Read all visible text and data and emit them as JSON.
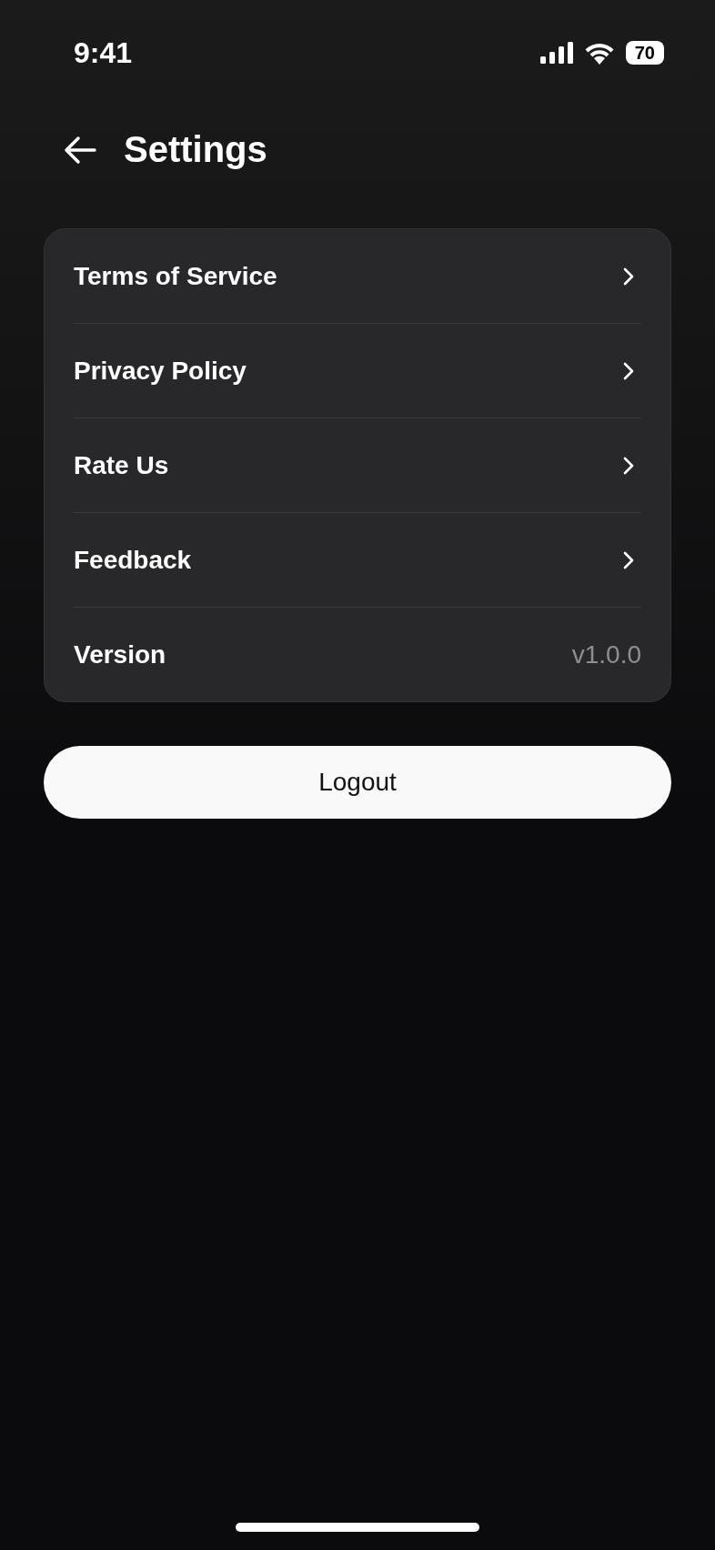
{
  "status_bar": {
    "time": "9:41",
    "battery": "70"
  },
  "header": {
    "title": "Settings"
  },
  "settings": [
    {
      "kind": "link",
      "label": "Terms of Service"
    },
    {
      "kind": "link",
      "label": "Privacy Policy"
    },
    {
      "kind": "link",
      "label": "Rate Us"
    },
    {
      "kind": "link",
      "label": "Feedback"
    },
    {
      "kind": "value",
      "label": "Version",
      "value": "v1.0.0"
    }
  ],
  "logout_button": {
    "label": "Logout"
  }
}
